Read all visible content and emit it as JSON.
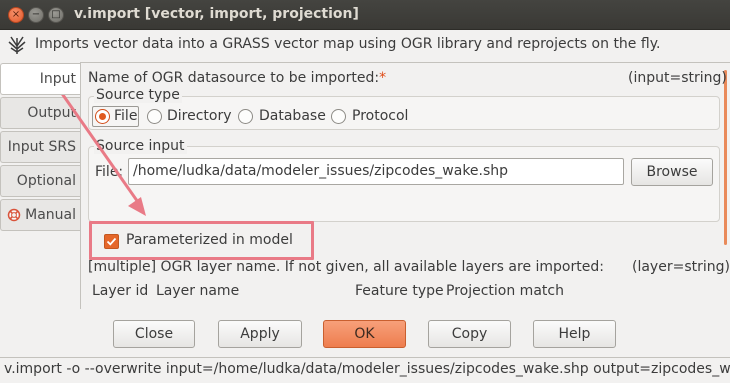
{
  "window": {
    "title": "v.import [vector, import, projection]",
    "close_glyph": "×",
    "minimize_glyph": "−",
    "maximize_glyph": "□"
  },
  "description": "Imports vector data into a GRASS vector map using OGR library and reprojects on the fly.",
  "tabs": [
    {
      "label": "Input",
      "active": true
    },
    {
      "label": "Output",
      "active": false
    },
    {
      "label": "Input SRS",
      "active": false
    },
    {
      "label": "Optional",
      "active": false
    },
    {
      "label": "Manual",
      "active": false,
      "icon": "lifebuoy-icon"
    }
  ],
  "input": {
    "datasource_label": "Name of OGR datasource to be imported:",
    "required_marker": "*",
    "datasource_param": "(input=string)",
    "source_type": {
      "title": "Source type",
      "options": [
        "File",
        "Directory",
        "Database",
        "Protocol"
      ],
      "selected": "File"
    },
    "source_input": {
      "title": "Source input",
      "file_label": "File:",
      "file_value": "/home/ludka/data/modeler_issues/zipcodes_wake.shp",
      "browse_label": "Browse"
    },
    "parameterized": {
      "label": "Parameterized in model",
      "checked": true
    },
    "layer_label": "[multiple] OGR layer name. If not given, all available layers are imported:",
    "layer_param": "(layer=string)",
    "layer_table_headers": [
      "Layer id",
      "Layer name",
      "Feature type",
      "Projection match"
    ]
  },
  "buttons": {
    "close": "Close",
    "apply": "Apply",
    "ok": "OK",
    "copy": "Copy",
    "help": "Help"
  },
  "command_line": "v.import -o --overwrite input=/home/ludka/data/modeler_issues/zipcodes_wake.shp output=zipcodes_wake",
  "colors": {
    "accent": "#e5672a",
    "annotation": "#e97a86",
    "titlebar": "#3c3b37"
  }
}
